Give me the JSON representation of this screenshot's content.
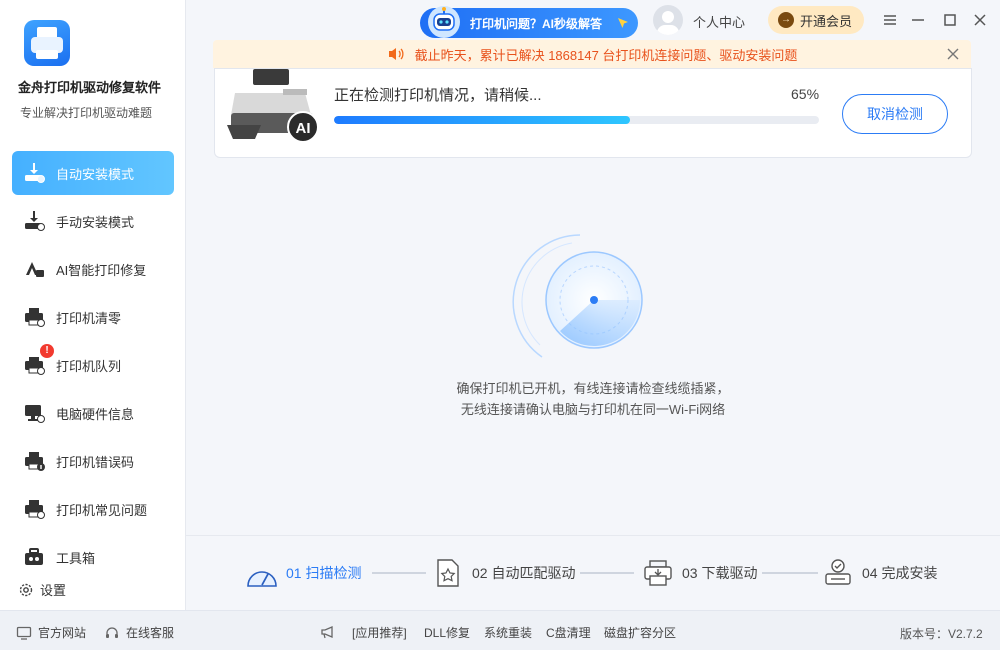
{
  "app": {
    "name": "金舟打印机驱动修复软件",
    "subtitle": "专业解决打印机驱动难题"
  },
  "sidebar": {
    "items": [
      {
        "label": "自动安装模式",
        "active": true,
        "icon": "auto-install-icon"
      },
      {
        "label": "手动安装模式",
        "icon": "manual-install-icon"
      },
      {
        "label": "AI智能打印修复",
        "icon": "ai-repair-icon"
      },
      {
        "label": "打印机清零",
        "icon": "printer-reset-icon"
      },
      {
        "label": "打印机队列",
        "icon": "printer-queue-icon",
        "badge": "!"
      },
      {
        "label": "电脑硬件信息",
        "icon": "hardware-info-icon"
      },
      {
        "label": "打印机错误码",
        "icon": "error-code-icon"
      },
      {
        "label": "打印机常见问题",
        "icon": "faq-icon"
      },
      {
        "label": "工具箱",
        "icon": "toolbox-icon"
      }
    ],
    "settings_label": "设置"
  },
  "topbar": {
    "ai_help": "打印机问题？AI秒级解答",
    "user_center": "个人中心",
    "vip": "开通会员",
    "vip_arrow": "→"
  },
  "notice": {
    "text": "截止昨天，累计已解决 1868147 台打印机连接问题、驱动安装问题"
  },
  "detect": {
    "status": "正在检测打印机情况，请稍候...",
    "percent_label": "65%",
    "progress": 0.61,
    "cancel_label": "取消检测"
  },
  "hints": {
    "line1": "确保打印机已开机，有线连接请检查线缆插紧，",
    "line2": "无线连接请确认电脑与打印机在同一Wi-Fi网络"
  },
  "steps": [
    {
      "label": "01  扫描检测",
      "active": true
    },
    {
      "label": "02  自动匹配驱动"
    },
    {
      "label": "03  下载驱动"
    },
    {
      "label": "04  完成安装"
    }
  ],
  "bottom": {
    "website": "官方网站",
    "service": "在线客服",
    "links": [
      "[应用推荐]",
      "DLL修复",
      "系统重装",
      "C盘清理",
      "磁盘扩容分区"
    ],
    "version": "版本号：V2.7.2"
  },
  "colors": {
    "accent": "#2c7cf5",
    "sidebar_active": "#45b0ff",
    "notice_text": "#e8521c",
    "notice_bg": "#fff3e0",
    "vip_bg": "#ffe9c2"
  }
}
